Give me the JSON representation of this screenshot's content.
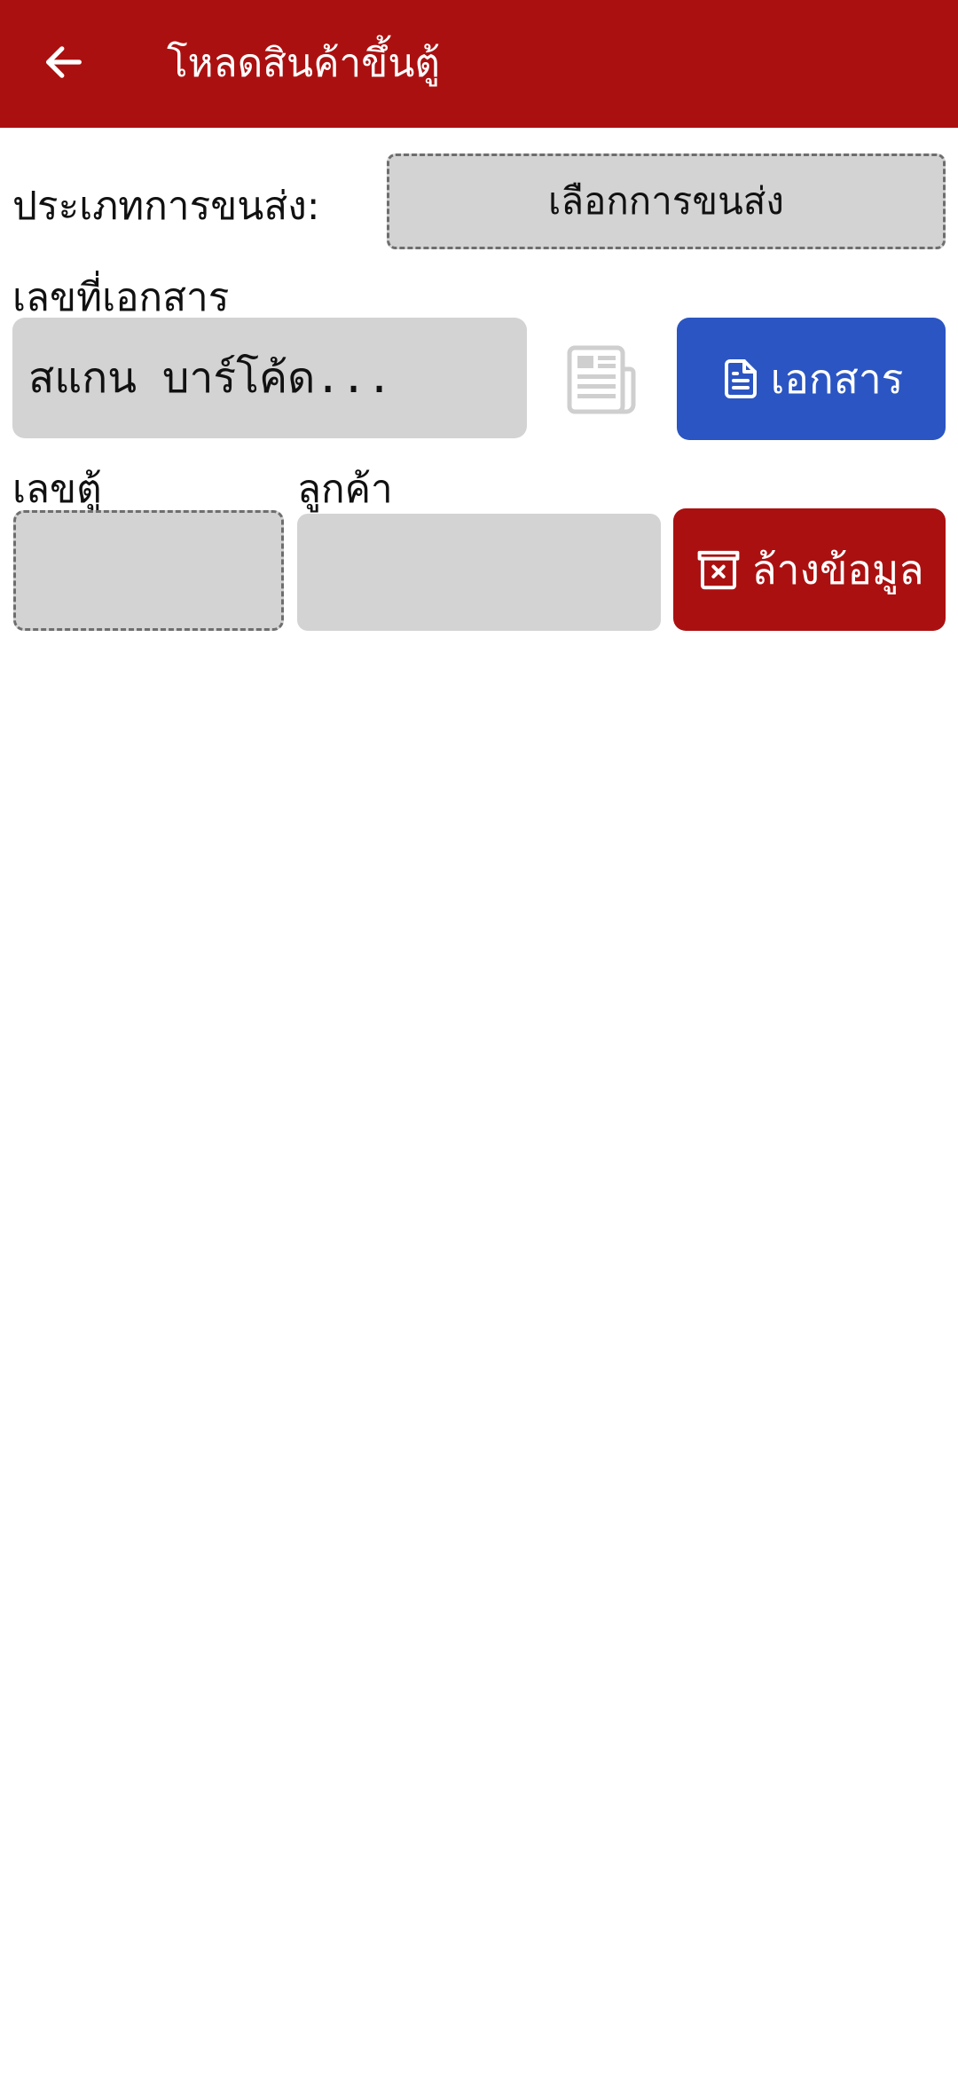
{
  "appbar": {
    "title": "โหลดสินค้าขึ้นตู้",
    "back_icon": "arrow-left-icon",
    "background": "#ab1010"
  },
  "transport": {
    "label": "ประเภทการขนส่ง:",
    "select_value": "เลือกการขนส่ง"
  },
  "document": {
    "label": "เลขที่เอกสาร",
    "scan_placeholder": "สแกน บาร์โค้ด...",
    "scan_value": "",
    "icon": "newspaper-icon",
    "button_label": "เอกสาร",
    "button_icon": "file-text-icon",
    "button_color": "#2b55c2"
  },
  "container": {
    "label": "เลขตู้",
    "value": ""
  },
  "customer": {
    "label": "ลูกค้า",
    "value": ""
  },
  "clear": {
    "button_label": "ล้างข้อมูล",
    "button_icon": "trash-x-icon",
    "button_color": "#ab1010"
  }
}
